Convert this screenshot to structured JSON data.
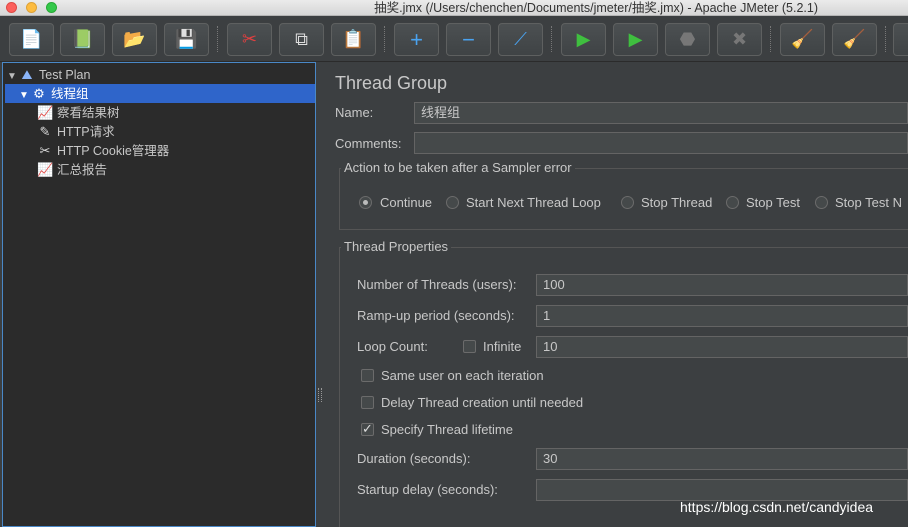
{
  "window": {
    "title": "抽奖.jmx (/Users/chenchen/Documents/jmeter/抽奖.jmx) - Apache JMeter (5.2.1)"
  },
  "toolbar": {
    "buttons": [
      {
        "icon": "new-icon",
        "glyph": "📄"
      },
      {
        "icon": "templates-icon",
        "glyph": "📗"
      },
      {
        "icon": "open-icon",
        "glyph": "📂"
      },
      {
        "icon": "save-icon",
        "glyph": "💾"
      },
      {
        "icon": "cut-icon",
        "glyph": "✂"
      },
      {
        "icon": "copy-icon",
        "glyph": "⧉"
      },
      {
        "icon": "paste-icon",
        "glyph": "📋"
      },
      {
        "icon": "expand-icon",
        "glyph": "+"
      },
      {
        "icon": "collapse-icon",
        "glyph": "−"
      },
      {
        "icon": "toggle-icon",
        "glyph": "⟋"
      },
      {
        "icon": "start-icon",
        "glyph": "▶"
      },
      {
        "icon": "start-no-pause-icon",
        "glyph": "▶"
      },
      {
        "icon": "stop-icon",
        "glyph": "⬣"
      },
      {
        "icon": "shutdown-icon",
        "glyph": "✖"
      },
      {
        "icon": "clear-icon",
        "glyph": "🧹"
      },
      {
        "icon": "clear-all-icon",
        "glyph": "🧹"
      }
    ]
  },
  "tree": {
    "items": [
      {
        "label": "Test Plan",
        "icon": "test-plan-icon",
        "glyph": "⛰"
      },
      {
        "label": "线程组",
        "icon": "thread-group-gear-icon",
        "glyph": "⚙"
      },
      {
        "label": "察看结果树",
        "icon": "listener-icon",
        "glyph": "📈"
      },
      {
        "label": "HTTP请求",
        "icon": "sampler-pen-icon",
        "glyph": "✎"
      },
      {
        "label": "HTTP Cookie管理器",
        "icon": "config-tools-icon",
        "glyph": "✂"
      },
      {
        "label": "汇总报告",
        "icon": "listener-icon",
        "glyph": "📈"
      }
    ]
  },
  "thread_group": {
    "title": "Thread Group",
    "name_label": "Name:",
    "name_value": "线程组",
    "comments_label": "Comments:",
    "comments_value": "",
    "sampler_error": {
      "title": "Action to be taken after a Sampler error",
      "options": [
        "Continue",
        "Start Next Thread Loop",
        "Stop Thread",
        "Stop Test",
        "Stop Test N"
      ],
      "selected": "Continue"
    },
    "properties": {
      "title": "Thread Properties",
      "threads_label": "Number of Threads (users):",
      "threads_value": "100",
      "rampup_label": "Ramp-up period (seconds):",
      "rampup_value": "1",
      "loop_label": "Loop Count:",
      "infinite_label": "Infinite",
      "infinite_checked": false,
      "loop_value": "10",
      "same_user_label": "Same user on each iteration",
      "same_user_checked": false,
      "delay_label": "Delay Thread creation until needed",
      "delay_checked": false,
      "lifetime_label": "Specify Thread lifetime",
      "lifetime_checked": true,
      "duration_label": "Duration (seconds):",
      "duration_value": "30",
      "startup_label": "Startup delay (seconds):",
      "startup_value": ""
    }
  },
  "watermark": "https://blog.csdn.net/candyidea",
  "colors": {
    "background": "#3c3f41",
    "tree_background": "#2b2b2b",
    "selection": "#2f65ca"
  }
}
